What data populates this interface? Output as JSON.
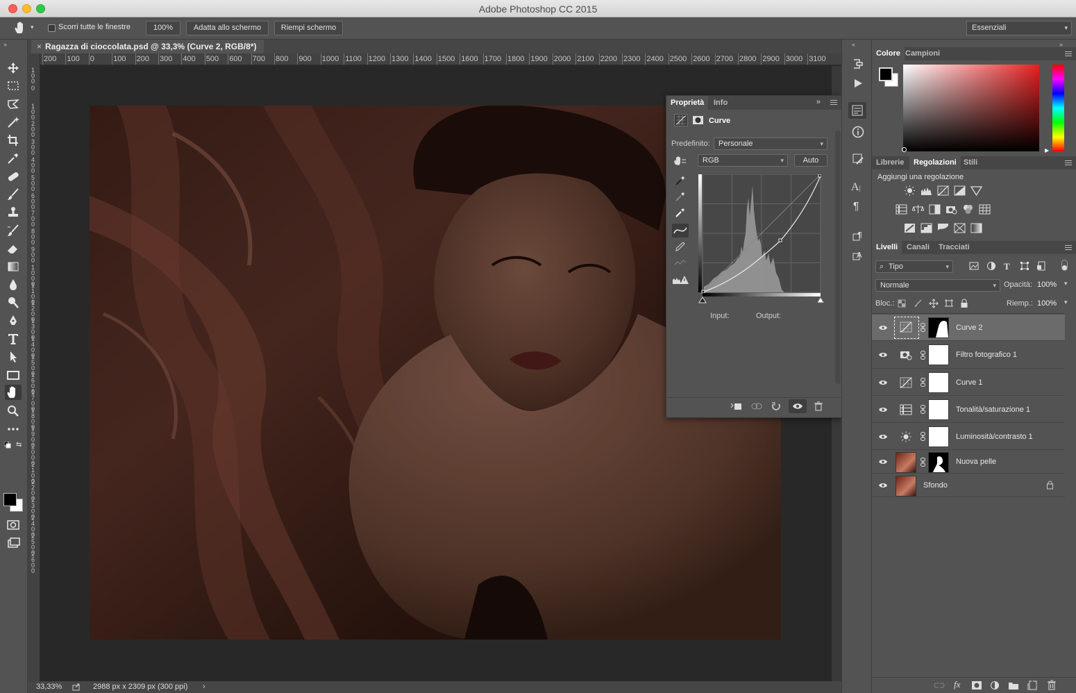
{
  "window": {
    "title": "Adobe Photoshop CC 2015"
  },
  "options_bar": {
    "scroll_all_label": "Scorri tutte le finestre",
    "zoom_button": "100%",
    "fit_screen_button": "Adatta allo schermo",
    "fill_screen_button": "Riempi schermo",
    "workspace": "Essenziali"
  },
  "document": {
    "tab_title": "Ragazza di cioccolata.psd @ 33,3% (Curve 2, RGB/8*)",
    "ruler_h": [
      "200",
      "100",
      "0",
      "100",
      "200",
      "300",
      "400",
      "500",
      "600",
      "700",
      "800",
      "900",
      "1000",
      "1100",
      "1200",
      "1300",
      "1400",
      "1500",
      "1600",
      "1700",
      "1800",
      "1900",
      "2000",
      "2100",
      "2200",
      "2300",
      "2400",
      "2500",
      "2600",
      "2700",
      "2800",
      "2900",
      "3000",
      "3100"
    ],
    "ruler_v": [
      "100",
      "0",
      "100",
      "200",
      "300",
      "400",
      "500",
      "600",
      "700",
      "800",
      "900",
      "1000",
      "1100",
      "1200",
      "1300",
      "1400",
      "1500",
      "1600",
      "1700",
      "1800",
      "1900",
      "2000",
      "2100",
      "2200",
      "2300",
      "2400",
      "2500",
      "2600"
    ],
    "zoom": "33,33%",
    "doc_info": "2988 px x 2309 px (300 ppi)"
  },
  "properties": {
    "tabs": [
      "Proprietà",
      "Info"
    ],
    "active_tab": "Proprietà",
    "adjustment_name": "Curve",
    "preset_label": "Predefinito:",
    "preset_value": "Personale",
    "channel_value": "RGB",
    "auto_button": "Auto",
    "input_label": "Input:",
    "output_label": "Output:"
  },
  "color_panel": {
    "tabs": [
      "Colore",
      "Campioni"
    ],
    "active_tab": "Colore",
    "foreground": "#000000",
    "background": "#ffffff",
    "hue_color": "#ff0000"
  },
  "adjustments_panel": {
    "tabs": [
      "Librerie",
      "Regolazioni",
      "Stili"
    ],
    "active_tab": "Regolazioni",
    "heading": "Aggiungi una regolazione"
  },
  "layers_panel": {
    "tabs": [
      "Livelli",
      "Canali",
      "Tracciati"
    ],
    "active_tab": "Livelli",
    "filter_kind": "Tipo",
    "blend_mode": "Normale",
    "opacity_label": "Opacità:",
    "opacity_value": "100%",
    "lock_label": "Bloc.:",
    "fill_label": "Riemp.:",
    "fill_value": "100%",
    "layers": [
      {
        "name": "Curve 2",
        "type": "curves",
        "selected": true
      },
      {
        "name": "Filtro fotografico 1",
        "type": "photo-filter",
        "selected": false
      },
      {
        "name": "Curve 1",
        "type": "curves",
        "selected": false
      },
      {
        "name": "Tonalità/saturazione 1",
        "type": "hue-saturation",
        "selected": false
      },
      {
        "name": "Luminosità/contrasto 1",
        "type": "brightness-contrast",
        "selected": false
      },
      {
        "name": "Nuova pelle",
        "type": "pixel-with-mask",
        "selected": false
      },
      {
        "name": "Sfondo",
        "type": "background",
        "selected": false
      }
    ]
  }
}
